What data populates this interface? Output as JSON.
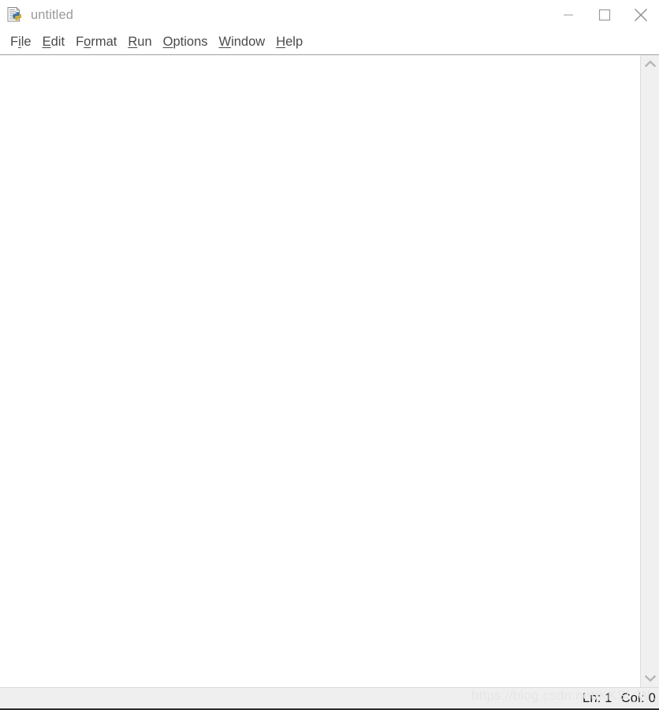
{
  "window": {
    "title": "untitled",
    "icon": "python-file-icon",
    "controls": [
      {
        "name": "minimize-button",
        "glyph": "minimize-icon",
        "label": "Minimize"
      },
      {
        "name": "maximize-button",
        "glyph": "maximize-icon",
        "label": "Maximize"
      },
      {
        "name": "close-button",
        "glyph": "close-icon",
        "label": "Close"
      }
    ]
  },
  "menubar": {
    "items": [
      {
        "label": "File",
        "pre": "F",
        "mnemonic": "i",
        "post": "le"
      },
      {
        "label": "Edit",
        "pre": "",
        "mnemonic": "E",
        "post": "dit"
      },
      {
        "label": "Format",
        "pre": "F",
        "mnemonic": "o",
        "post": "rmat"
      },
      {
        "label": "Run",
        "pre": "",
        "mnemonic": "R",
        "post": "un"
      },
      {
        "label": "Options",
        "pre": "",
        "mnemonic": "O",
        "post": "ptions"
      },
      {
        "label": "Window",
        "pre": "",
        "mnemonic": "W",
        "post": "indow"
      },
      {
        "label": "Help",
        "pre": "",
        "mnemonic": "H",
        "post": "elp"
      }
    ]
  },
  "editor": {
    "content": "",
    "placeholder": ""
  },
  "scrollbar": {
    "up_arrow": "chevron-up-icon",
    "down_arrow": "chevron-down-icon"
  },
  "statusbar": {
    "line_label": "Ln: 1",
    "col_label": "Col: 0"
  },
  "watermark": {
    "text": "https://blog.csdn.net/KKSI_W..."
  },
  "colors": {
    "titlebar_bg": "#ffffff",
    "menu_text": "#4a4a4a",
    "title_text": "#9a9a9a",
    "editor_bg": "#ffffff",
    "scrollbar_bg": "#f0f0f0",
    "statusbar_bg": "#efefef",
    "status_text": "#1b1b1b",
    "watermark": "#e6e6e6",
    "separator": "#a0a0a0"
  }
}
